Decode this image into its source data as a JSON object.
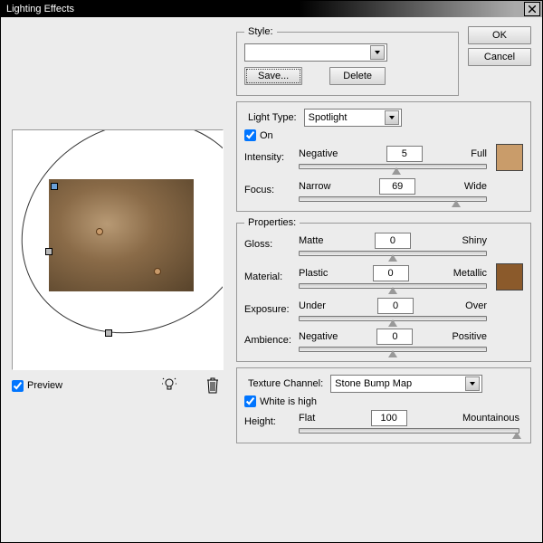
{
  "title": "Lighting Effects",
  "actions": {
    "ok": "OK",
    "cancel": "Cancel"
  },
  "style": {
    "label": "Style:",
    "save": "Save...",
    "delete": "Delete",
    "value": ""
  },
  "light": {
    "legend": "Light Type:",
    "type": "Spotlight",
    "on_label": "On",
    "intensity": {
      "label": "Intensity:",
      "left": "Negative",
      "right": "Full",
      "value": "5",
      "pos": 52
    },
    "focus": {
      "label": "Focus:",
      "left": "Narrow",
      "right": "Wide",
      "value": "69",
      "pos": 84
    }
  },
  "props": {
    "legend": "Properties:",
    "gloss": {
      "label": "Gloss:",
      "left": "Matte",
      "right": "Shiny",
      "value": "0",
      "pos": 50
    },
    "material": {
      "label": "Material:",
      "left": "Plastic",
      "right": "Metallic",
      "value": "0",
      "pos": 50
    },
    "exposure": {
      "label": "Exposure:",
      "left": "Under",
      "right": "Over",
      "value": "0",
      "pos": 50
    },
    "ambience": {
      "label": "Ambience:",
      "left": "Negative",
      "right": "Positive",
      "value": "0",
      "pos": 50
    }
  },
  "tex": {
    "legend": "Texture Channel:",
    "value": "Stone Bump Map",
    "white": "White is high",
    "height": {
      "label": "Height:",
      "left": "Flat",
      "right": "Mountainous",
      "value": "100",
      "pos": 100
    }
  },
  "preview": {
    "label": "Preview"
  }
}
